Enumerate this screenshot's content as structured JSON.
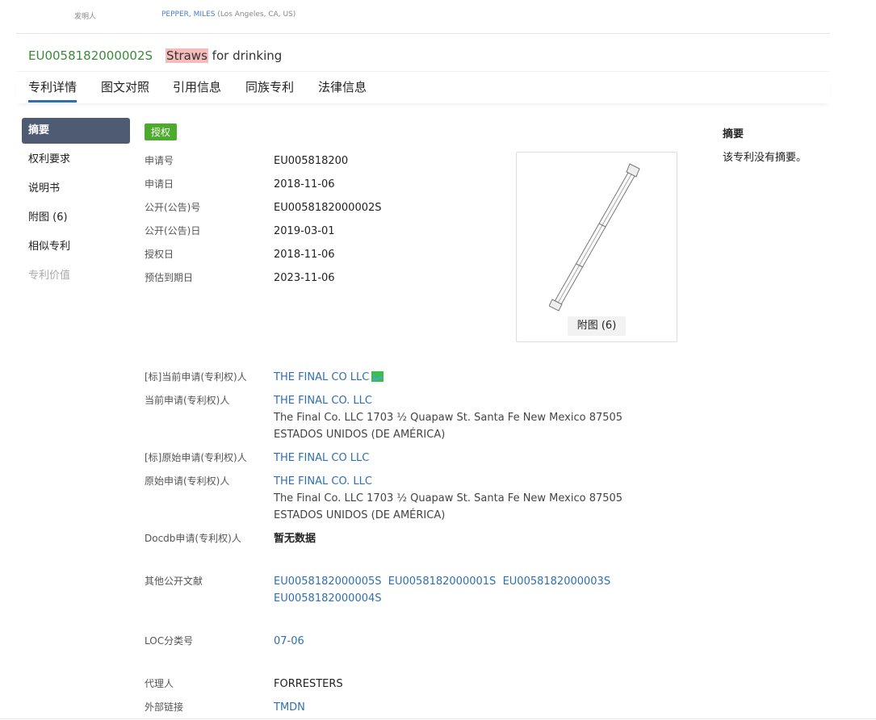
{
  "inventor": {
    "label": "发明人",
    "name": "PEPPER, MILES",
    "location": "(Los Angeles, CA, US)"
  },
  "title": {
    "pub_no": "EU0058182000002S",
    "highlight": "Straws",
    "rest": " for drinking"
  },
  "tabs": [
    {
      "label": "专利详情"
    },
    {
      "label": "图文对照"
    },
    {
      "label": "引用信息"
    },
    {
      "label": "同族专利"
    },
    {
      "label": "法律信息"
    }
  ],
  "nav": [
    {
      "label": "摘要"
    },
    {
      "label": "权利要求"
    },
    {
      "label": "说明书"
    },
    {
      "label": "附图 (6)"
    },
    {
      "label": "相似专利"
    },
    {
      "label": "专利价值"
    }
  ],
  "status_badge": "授权",
  "basic": [
    {
      "key": "申请号",
      "value": "EU005818200"
    },
    {
      "key": "申请日",
      "value": "2018-11-06"
    },
    {
      "key": "公开(公告)号",
      "value": "EU0058182000002S"
    },
    {
      "key": "公开(公告)日",
      "value": "2019-03-01"
    },
    {
      "key": "授权日",
      "value": "2018-11-06"
    },
    {
      "key": "预估到期日",
      "value": "2023-11-06"
    }
  ],
  "figure": {
    "button": "附图 (6)"
  },
  "parties": {
    "std_current_label": "[标]当前申请(专利权)人",
    "std_current": "THE FINAL CO LLC",
    "current_label": "当前申请(专利权)人",
    "current": "THE FINAL CO. LLC",
    "current_addr": "The Final Co. LLC 1703 ½ Quapaw St. Santa Fe New Mexico 87505 ESTADOS UNIDOS (DE AMÉRICA)",
    "std_original_label": "[标]原始申请(专利权)人",
    "std_original": "THE FINAL CO LLC",
    "original_label": "原始申请(专利权)人",
    "original": "THE FINAL CO. LLC",
    "original_addr": "The Final Co. LLC 1703 ½ Quapaw St. Santa Fe New Mexico 87505 ESTADOS UNIDOS (DE AMÉRICA)",
    "docdb_label": "Docdb申请(专利权)人",
    "docdb": "暂无数据"
  },
  "other_pubs": {
    "label": "其他公开文献",
    "items": [
      "EU0058182000005S",
      "EU0058182000001S",
      "EU0058182000003S",
      "EU0058182000004S"
    ]
  },
  "loc": {
    "label": "LOC分类号",
    "value": "07-06"
  },
  "agent": {
    "label": "代理人",
    "value": "FORRESTERS"
  },
  "external": {
    "label": "外部链接",
    "value": "TMDN"
  },
  "abstract": {
    "heading": "摘要",
    "text": "该专利没有摘要。"
  }
}
